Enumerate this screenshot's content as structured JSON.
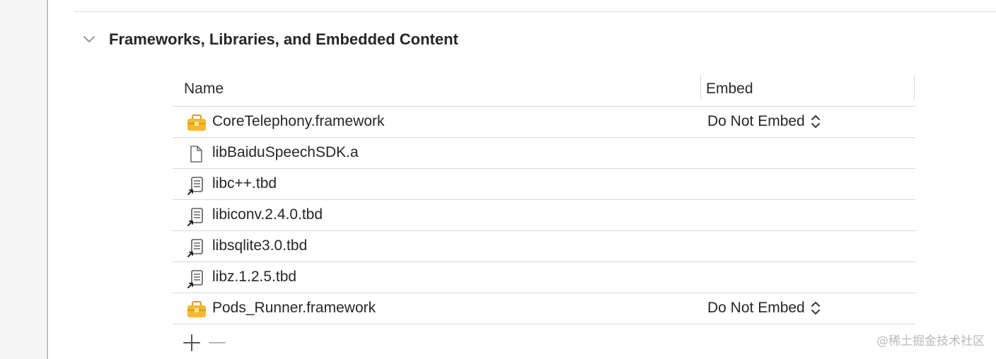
{
  "section": {
    "title": "Frameworks, Libraries, and Embedded Content"
  },
  "table": {
    "headers": {
      "name": "Name",
      "embed": "Embed"
    },
    "rows": [
      {
        "name": "CoreTelephony.framework",
        "icon": "toolbox-icon",
        "embed": "Do Not Embed"
      },
      {
        "name": "libBaiduSpeechSDK.a",
        "icon": "file-icon",
        "embed": ""
      },
      {
        "name": "libc++.tbd",
        "icon": "alias-text-file-icon",
        "embed": ""
      },
      {
        "name": "libiconv.2.4.0.tbd",
        "icon": "alias-text-file-icon",
        "embed": ""
      },
      {
        "name": "libsqlite3.0.tbd",
        "icon": "alias-text-file-icon",
        "embed": ""
      },
      {
        "name": "libz.1.2.5.tbd",
        "icon": "alias-text-file-icon",
        "embed": ""
      },
      {
        "name": "Pods_Runner.framework",
        "icon": "toolbox-icon",
        "embed": "Do Not Embed"
      }
    ]
  },
  "toolbar": {
    "add_icon": "plus-icon",
    "remove_icon": "minus-icon"
  },
  "watermark": "@稀土掘金技术社区",
  "colors": {
    "toolbox_yellow": "#f5b82e",
    "divider": "#d9d9d9",
    "text": "#262626"
  }
}
